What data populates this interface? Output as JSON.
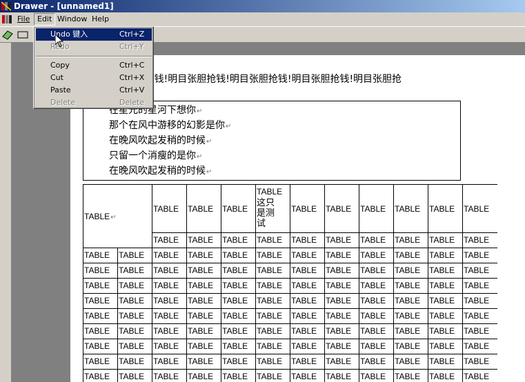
{
  "window": {
    "title": "Drawer - [unnamed1]"
  },
  "menubar": {
    "file": "File",
    "edit": "Edit",
    "window": "Window",
    "help": "Help"
  },
  "edit_menu": {
    "undo": {
      "label": "Undo 键入",
      "shortcut": "Ctrl+Z"
    },
    "redo": {
      "label": "Redo",
      "shortcut": "Ctrl+Y"
    },
    "copy": {
      "label": "Copy",
      "shortcut": "Ctrl+C"
    },
    "cut": {
      "label": "Cut",
      "shortcut": "Ctrl+X"
    },
    "paste": {
      "label": "Paste",
      "shortcut": "Ctrl+V"
    },
    "delete": {
      "label": "Delete",
      "shortcut": "Delete"
    }
  },
  "document": {
    "marquee_text": "抢钱!明目张胆抢钱!明目张胆抢钱!明目张胆抢钱!明目张胆抢钱!明目张胆抢",
    "poem_lines": [
      "在星光的星河下想你",
      "那个在风中游移的幻影是你",
      "在晚风吹起发稍的时候",
      "只留一个消瘦的是你",
      "在晚风吹起发稍的时候"
    ],
    "table": {
      "merged_cell": "TABLE",
      "cell_text": "TABLE",
      "special_cell_lines": [
        "TABLE",
        "这只",
        "是测",
        "试"
      ]
    }
  },
  "colors": {
    "titlebar": "#0a246a",
    "menu_highlight": "#0a246a",
    "workspace": "#808080"
  }
}
